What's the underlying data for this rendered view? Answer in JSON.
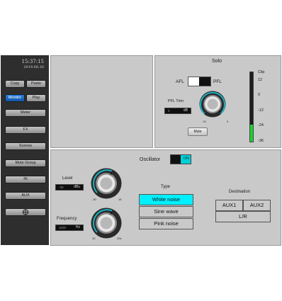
{
  "sidebar": {
    "time": "15:37:15",
    "date": "2019.08.20",
    "buttons": {
      "copy": "Copy",
      "paste": "Paste",
      "monitor": "Monitor",
      "play": "Play",
      "meter": "Meter",
      "fx": "FX",
      "scenes": "Scenes",
      "mute_group": "Mute Group",
      "in": "IN",
      "aux": "AUX"
    },
    "active": "monitor"
  },
  "solo": {
    "title": "Solo",
    "afl_label": "AFL",
    "pfl_label": "PFL",
    "pfl_trim_label": "PFL Trim",
    "pfl_trim_value": "0",
    "pfl_trim_unit": "dB",
    "knob_min": "-76",
    "knob_max": "0",
    "mute_label": "Mute",
    "meter": {
      "label": "Clip",
      "ticks": [
        "12",
        "0",
        "-12",
        "-24",
        "-36"
      ],
      "level": 0.25,
      "color": "#1bd32e"
    }
  },
  "oscillator": {
    "title": "Oscillator",
    "on_label": "ON",
    "on": true,
    "accent": "#00f0ff",
    "level_label": "Level",
    "level_value": "-30",
    "level_unit": "dBu",
    "level_min": "-30",
    "level_max": "18",
    "frequency_label": "Frequency",
    "frequency_value": "1000",
    "frequency_unit": "Hz",
    "frequency_min": "10",
    "frequency_max": "20k",
    "type_label": "Type",
    "types": [
      "White noise",
      "Sine wave",
      "Pink noise"
    ],
    "selected_type": "White noise",
    "destination_label": "Destination",
    "destinations": {
      "aux1": "AUX1",
      "aux2": "AUX2",
      "lr": "L/R"
    }
  },
  "icons": {
    "target": "crosshair-icon"
  }
}
